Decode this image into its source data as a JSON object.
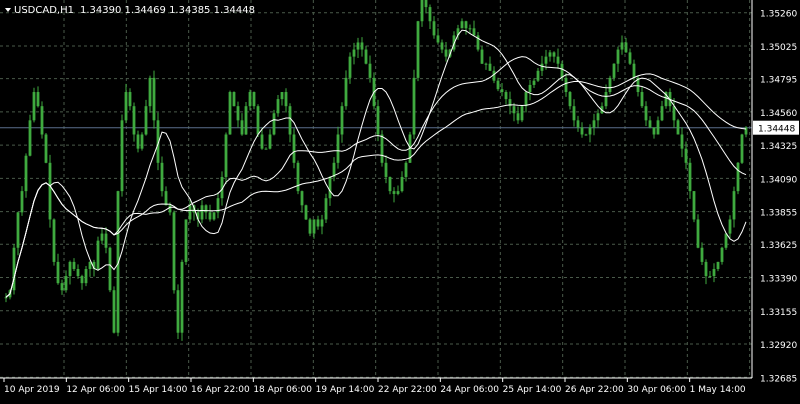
{
  "header": {
    "symbol": "USDCAD,H1",
    "ohlc": "1.34390 1.34469 1.34385 1.34448"
  },
  "colors": {
    "background": "#000000",
    "grid": "#4a5a4a",
    "candles": "#3faa3f",
    "moving_averages": "#ffffff",
    "price_line": "#5a6e8c",
    "text": "#ffffff"
  },
  "chart_data": {
    "type": "candlestick",
    "title": "",
    "symbol": "USDCAD",
    "timeframe": "H1",
    "xlabel": "",
    "ylabel": "",
    "ylim": [
      1.3268,
      1.3535
    ],
    "y_ticks": [
      "1.35260",
      "1.35025",
      "1.34795",
      "1.34560",
      "1.34325",
      "1.34090",
      "1.33855",
      "1.33625",
      "1.33390",
      "1.33155",
      "1.32920",
      "1.32685"
    ],
    "x_ticks": [
      "10 Apr 2019",
      "12 Apr 06:00",
      "15 Apr 14:00",
      "16 Apr 22:00",
      "18 Apr 06:00",
      "19 Apr 14:00",
      "22 Apr 22:00",
      "24 Apr 06:00",
      "25 Apr 14:00",
      "26 Apr 22:00",
      "30 Apr 06:00",
      "1 May 14:00"
    ],
    "current_price": "1.34448",
    "grid": true,
    "close_series": [
      1.3325,
      1.333,
      1.336,
      1.3385,
      1.34,
      1.3425,
      1.345,
      1.347,
      1.346,
      1.344,
      1.342,
      1.338,
      1.335,
      1.3335,
      1.333,
      1.334,
      1.335,
      1.3345,
      1.334,
      1.3335,
      1.3345,
      1.335,
      1.3345,
      1.3365,
      1.337,
      1.336,
      1.333,
      1.33,
      1.34,
      1.345,
      1.347,
      1.346,
      1.344,
      1.343,
      1.344,
      1.346,
      1.348,
      1.345,
      1.342,
      1.34,
      1.339,
      1.3385,
      1.333,
      1.33,
      1.335,
      1.338,
      1.339,
      1.3385,
      1.338,
      1.339,
      1.3385,
      1.338,
      1.3385,
      1.3395,
      1.341,
      1.344,
      1.347,
      1.346,
      1.345,
      1.344,
      1.346,
      1.347,
      1.346,
      1.344,
      1.343,
      1.343,
      1.344,
      1.3455,
      1.3465,
      1.347,
      1.346,
      1.344,
      1.342,
      1.34,
      1.339,
      1.338,
      1.337,
      1.338,
      1.3375,
      1.338,
      1.3395,
      1.341,
      1.342,
      1.344,
      1.346,
      1.348,
      1.3495,
      1.35,
      1.3505,
      1.35,
      1.349,
      1.348,
      1.346,
      1.344,
      1.342,
      1.341,
      1.34,
      1.3398,
      1.34,
      1.341,
      1.342,
      1.344,
      1.348,
      1.352,
      1.354,
      1.353,
      1.352,
      1.351,
      1.3505,
      1.35,
      1.3495,
      1.35,
      1.351,
      1.3515,
      1.352,
      1.3515,
      1.3515,
      1.351,
      1.35,
      1.349,
      1.349,
      1.3485,
      1.3478,
      1.3472,
      1.347,
      1.3465,
      1.346,
      1.3455,
      1.345,
      1.346,
      1.347,
      1.3475,
      1.3478,
      1.3485,
      1.349,
      1.3495,
      1.3498,
      1.3495,
      1.349,
      1.348,
      1.347,
      1.346,
      1.345,
      1.3445,
      1.344,
      1.344,
      1.3445,
      1.345,
      1.3455,
      1.346,
      1.347,
      1.348,
      1.349,
      1.35,
      1.3505,
      1.3498,
      1.349,
      1.348,
      1.347,
      1.346,
      1.345,
      1.3445,
      1.344,
      1.345,
      1.346,
      1.347,
      1.346,
      1.345,
      1.344,
      1.343,
      1.342,
      1.34,
      1.338,
      1.336,
      1.335,
      1.334,
      1.334,
      1.3345,
      1.335,
      1.336,
      1.337,
      1.338,
      1.34,
      1.342,
      1.344,
      1.3445
    ]
  }
}
